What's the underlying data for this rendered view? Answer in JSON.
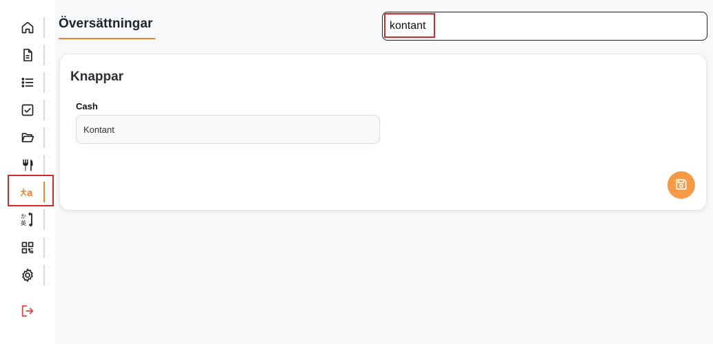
{
  "page": {
    "title": "Översättningar"
  },
  "search": {
    "value": "kontant"
  },
  "card": {
    "title": "Knappar",
    "field_label": "Cash",
    "field_value": "Kontant"
  },
  "sidebar": {
    "items": [
      {
        "icon": "home-icon"
      },
      {
        "icon": "document-icon"
      },
      {
        "icon": "list-icon"
      },
      {
        "icon": "checkbox-icon"
      },
      {
        "icon": "folder-open-icon"
      },
      {
        "icon": "utensils-icon"
      },
      {
        "icon": "translate-icon",
        "active": true
      },
      {
        "icon": "japanese-translate-icon"
      },
      {
        "icon": "qr-code-icon"
      },
      {
        "icon": "gear-icon"
      },
      {
        "icon": "logout-icon"
      }
    ]
  },
  "colors": {
    "accent": "#f2812a",
    "highlight_border": "#d9262b",
    "logout": "#e0443e",
    "save_button": "#f79a45"
  }
}
